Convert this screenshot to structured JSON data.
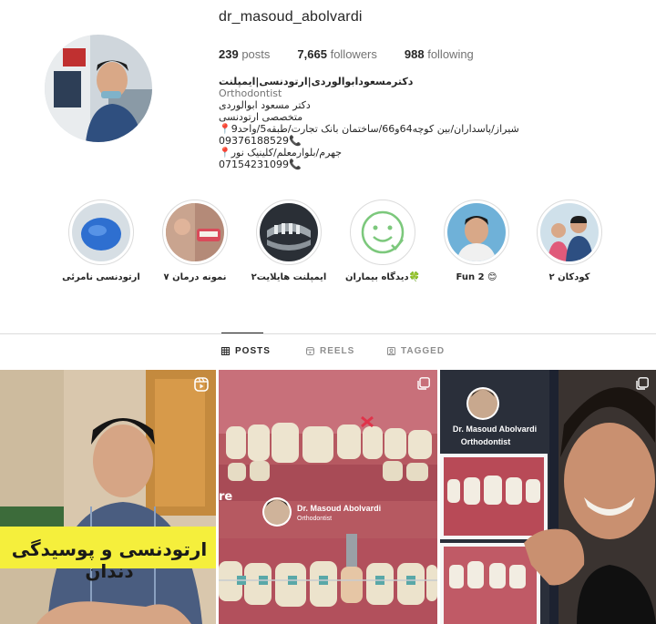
{
  "profile": {
    "username": "dr_masoud_abolvardi",
    "posts_count": "239",
    "posts_label": "posts",
    "followers_count": "7,665",
    "followers_label": "followers",
    "following_count": "988",
    "following_label": "following",
    "display_name": "دکترمسعودابوالوردی|ارتودنسی|ایمپلنت",
    "category": "Orthodontist",
    "bio_lines": [
      "دکتر مسعود ابوالوردی",
      "متخصصی ارتودنسی",
      "📍شیراز/پاسداران/بین کوچه64و66/ساختمان بانک تجارت/طبقه5/واحد9",
      "09376188529📞",
      "📍جهرم/بلوارمعلم/کلینیک نور",
      "07154231099📞"
    ]
  },
  "highlights": [
    {
      "label": "ارتودنسی نامرئی"
    },
    {
      "label": "نمونه درمان ۷"
    },
    {
      "label": "ایمپلنت هایلایت۲"
    },
    {
      "label": "دیدگاه بیماران🍀"
    },
    {
      "label": "Fun 2 😊"
    },
    {
      "label": "کودکان ۲"
    }
  ],
  "tabs": [
    {
      "label": "POSTS",
      "icon": "grid-icon",
      "active": true
    },
    {
      "label": "REELS",
      "icon": "reels-icon",
      "active": false
    },
    {
      "label": "TAGGED",
      "icon": "tagged-icon",
      "active": false
    }
  ],
  "posts": [
    {
      "type": "reel",
      "overlay_text": "ارتودنسی و پوسیدگی دندان"
    },
    {
      "type": "carousel",
      "partial_text": "re",
      "badge_name": "Dr. Masoud Abolvardi",
      "badge_title": "Orthodontist"
    },
    {
      "type": "carousel",
      "badge_name": "Dr. Masoud Abolvardi",
      "badge_title": "Orthodontist"
    }
  ],
  "colors": {
    "text": "#262626",
    "muted": "#737373",
    "border": "#dbdbdb",
    "overlay_yellow": "#f5ef3c"
  }
}
